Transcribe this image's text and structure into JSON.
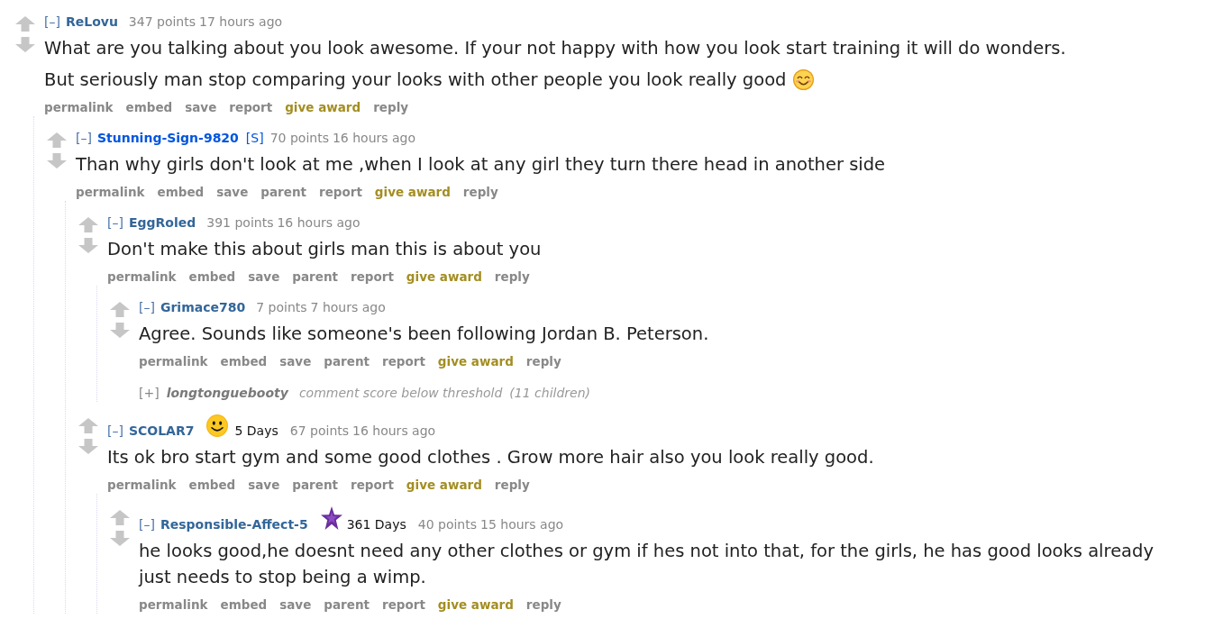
{
  "comments": [
    {
      "kind": "comment",
      "toggle": "[–]",
      "author": "ReLovu",
      "submitter": false,
      "score": "347 points",
      "time": "17 hours ago",
      "paragraphs": [
        {
          "kind": "plain",
          "text": "What are you talking about you look awesome. If your not happy with how you look start training it will do wonders."
        },
        {
          "kind": "emoji",
          "text": "But seriously man stop comparing your looks with other people you look really good"
        }
      ],
      "actions": [
        {
          "label": "permalink",
          "kind": "link"
        },
        {
          "label": "embed",
          "kind": "link"
        },
        {
          "label": "save",
          "kind": "link"
        },
        {
          "label": "report",
          "kind": "link"
        },
        {
          "label": "give award",
          "kind": "award"
        },
        {
          "label": "reply",
          "kind": "link"
        }
      ],
      "children": [
        {
          "kind": "comment",
          "toggle": "[–]",
          "author": "Stunning-Sign-9820",
          "submitter": true,
          "tag": "[S]",
          "score": "70 points",
          "time": "16 hours ago",
          "paragraphs": [
            {
              "kind": "plain",
              "text": "Than why girls don't look at me ,when I look at any girl they turn there head in another side"
            }
          ],
          "actions": [
            {
              "label": "permalink",
              "kind": "link"
            },
            {
              "label": "embed",
              "kind": "link"
            },
            {
              "label": "save",
              "kind": "link"
            },
            {
              "label": "parent",
              "kind": "link"
            },
            {
              "label": "report",
              "kind": "link"
            },
            {
              "label": "give award",
              "kind": "award"
            },
            {
              "label": "reply",
              "kind": "link"
            }
          ],
          "children": [
            {
              "kind": "comment",
              "toggle": "[–]",
              "author": "EggRoled",
              "submitter": false,
              "score": "391 points",
              "time": "16 hours ago",
              "paragraphs": [
                {
                  "kind": "plain",
                  "text": "Don't make this about girls man this is about you"
                }
              ],
              "actions": [
                {
                  "label": "permalink",
                  "kind": "link"
                },
                {
                  "label": "embed",
                  "kind": "link"
                },
                {
                  "label": "save",
                  "kind": "link"
                },
                {
                  "label": "parent",
                  "kind": "link"
                },
                {
                  "label": "report",
                  "kind": "link"
                },
                {
                  "label": "give award",
                  "kind": "award"
                },
                {
                  "label": "reply",
                  "kind": "link"
                }
              ],
              "children": [
                {
                  "kind": "comment",
                  "toggle": "[–]",
                  "author": "Grimace780",
                  "submitter": false,
                  "score": "7 points",
                  "time": "7 hours ago",
                  "paragraphs": [
                    {
                      "kind": "plain",
                      "text": "Agree. Sounds like someone's been following Jordan B. Peterson."
                    }
                  ],
                  "actions": [
                    {
                      "label": "permalink",
                      "kind": "link"
                    },
                    {
                      "label": "embed",
                      "kind": "link"
                    },
                    {
                      "label": "save",
                      "kind": "link"
                    },
                    {
                      "label": "parent",
                      "kind": "link"
                    },
                    {
                      "label": "report",
                      "kind": "link"
                    },
                    {
                      "label": "give award",
                      "kind": "award"
                    },
                    {
                      "label": "reply",
                      "kind": "link"
                    }
                  ]
                },
                {
                  "kind": "collapsed",
                  "toggle": "[+]",
                  "author": "longtonguebooty",
                  "note": "comment score below threshold",
                  "children_count": "(11 children)"
                }
              ]
            },
            {
              "kind": "comment",
              "toggle": "[–]",
              "author": "SCOLAR7",
              "submitter": false,
              "flair": {
                "kind": "face",
                "text": "5 Days"
              },
              "score": "67 points",
              "time": "16 hours ago",
              "paragraphs": [
                {
                  "kind": "plain",
                  "text": "Its ok bro start gym and some good clothes . Grow more hair also you look really good."
                }
              ],
              "actions": [
                {
                  "label": "permalink",
                  "kind": "link"
                },
                {
                  "label": "embed",
                  "kind": "link"
                },
                {
                  "label": "save",
                  "kind": "link"
                },
                {
                  "label": "parent",
                  "kind": "link"
                },
                {
                  "label": "report",
                  "kind": "link"
                },
                {
                  "label": "give award",
                  "kind": "award"
                },
                {
                  "label": "reply",
                  "kind": "link"
                }
              ],
              "children": [
                {
                  "kind": "comment",
                  "toggle": "[–]",
                  "author": "Responsible-Affect-5",
                  "submitter": false,
                  "flair": {
                    "kind": "star",
                    "text": "361 Days"
                  },
                  "score": "40 points",
                  "time": "15 hours ago",
                  "paragraphs": [
                    {
                      "kind": "plain",
                      "text": "he looks good,he doesnt need any other clothes or gym if hes not into that, for the girls, he has good looks already just needs to stop being a wimp."
                    }
                  ],
                  "actions": [
                    {
                      "label": "permalink",
                      "kind": "link"
                    },
                    {
                      "label": "embed",
                      "kind": "link"
                    },
                    {
                      "label": "save",
                      "kind": "link"
                    },
                    {
                      "label": "parent",
                      "kind": "link"
                    },
                    {
                      "label": "report",
                      "kind": "link"
                    },
                    {
                      "label": "give award",
                      "kind": "award"
                    },
                    {
                      "label": "reply",
                      "kind": "link"
                    }
                  ]
                }
              ]
            }
          ]
        }
      ]
    }
  ]
}
